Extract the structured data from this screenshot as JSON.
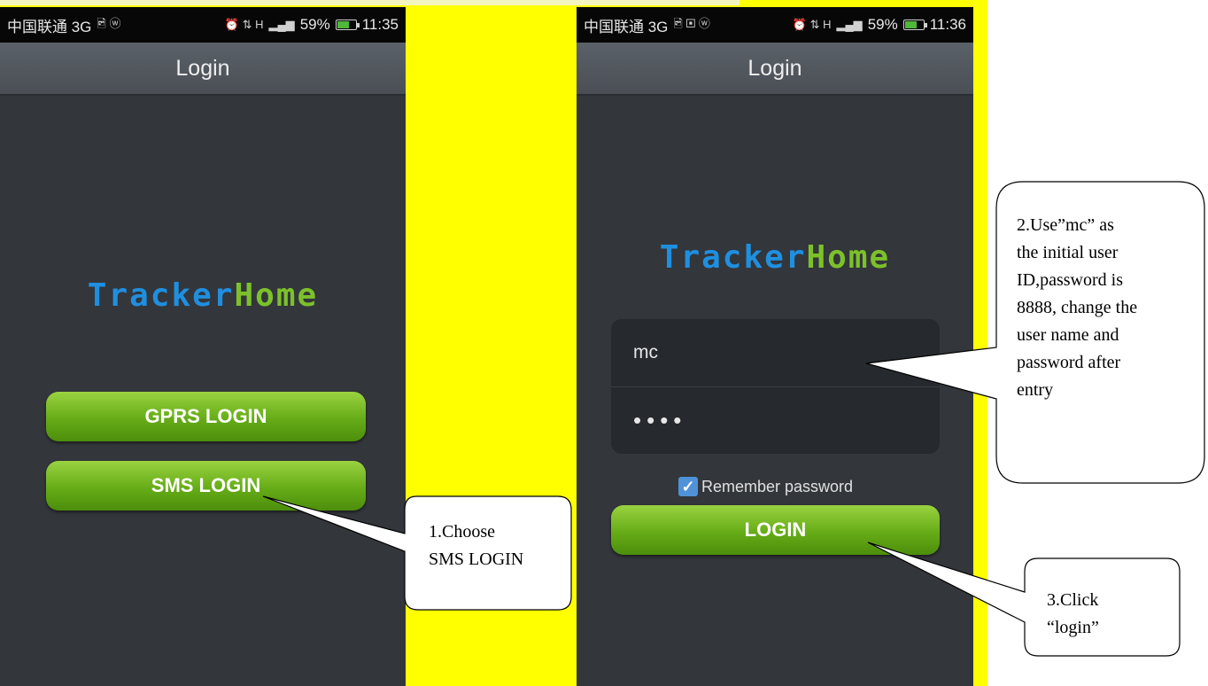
{
  "left_phone": {
    "status": {
      "carrier": "中国联通 3G",
      "left_icons": "🖻 ⓦ",
      "right_icons": "⏰ ⇅ H",
      "signal": "▂▄▆",
      "battery": "59%",
      "time": "11:35"
    },
    "title": "Login",
    "logo": {
      "part1": "Tracker",
      "part2": "Home"
    },
    "gprs_button": "GPRS LOGIN",
    "sms_button": "SMS LOGIN"
  },
  "right_phone": {
    "status": {
      "carrier": "中国联通 3G",
      "left_icons": "🖻 ▣ ⓦ",
      "right_icons": "⏰ ⇅ H",
      "signal": "▂▄▆",
      "battery": "59%",
      "time": "11:36"
    },
    "title": "Login",
    "logo": {
      "part1": "Tracker",
      "part2": "Home"
    },
    "username_value": "mc",
    "password_value": "••••",
    "remember_label": "Remember password",
    "remember_checked": true,
    "login_button": "LOGIN"
  },
  "callouts": {
    "step1": [
      "1.Choose",
      "SMS LOGIN"
    ],
    "step2": [
      "2.Use”mc” as",
      "the initial user",
      "ID,password is",
      "8888, change the",
      "user name and",
      "password after",
      "entry"
    ],
    "step3": [
      "3.Click",
      "“login”"
    ]
  },
  "colors": {
    "highlight": "#ffff00",
    "phone_bg": "#33363b",
    "button_green": "#7cc12a",
    "logo_blue": "#1f8fe0",
    "logo_green": "#7cc12a"
  }
}
